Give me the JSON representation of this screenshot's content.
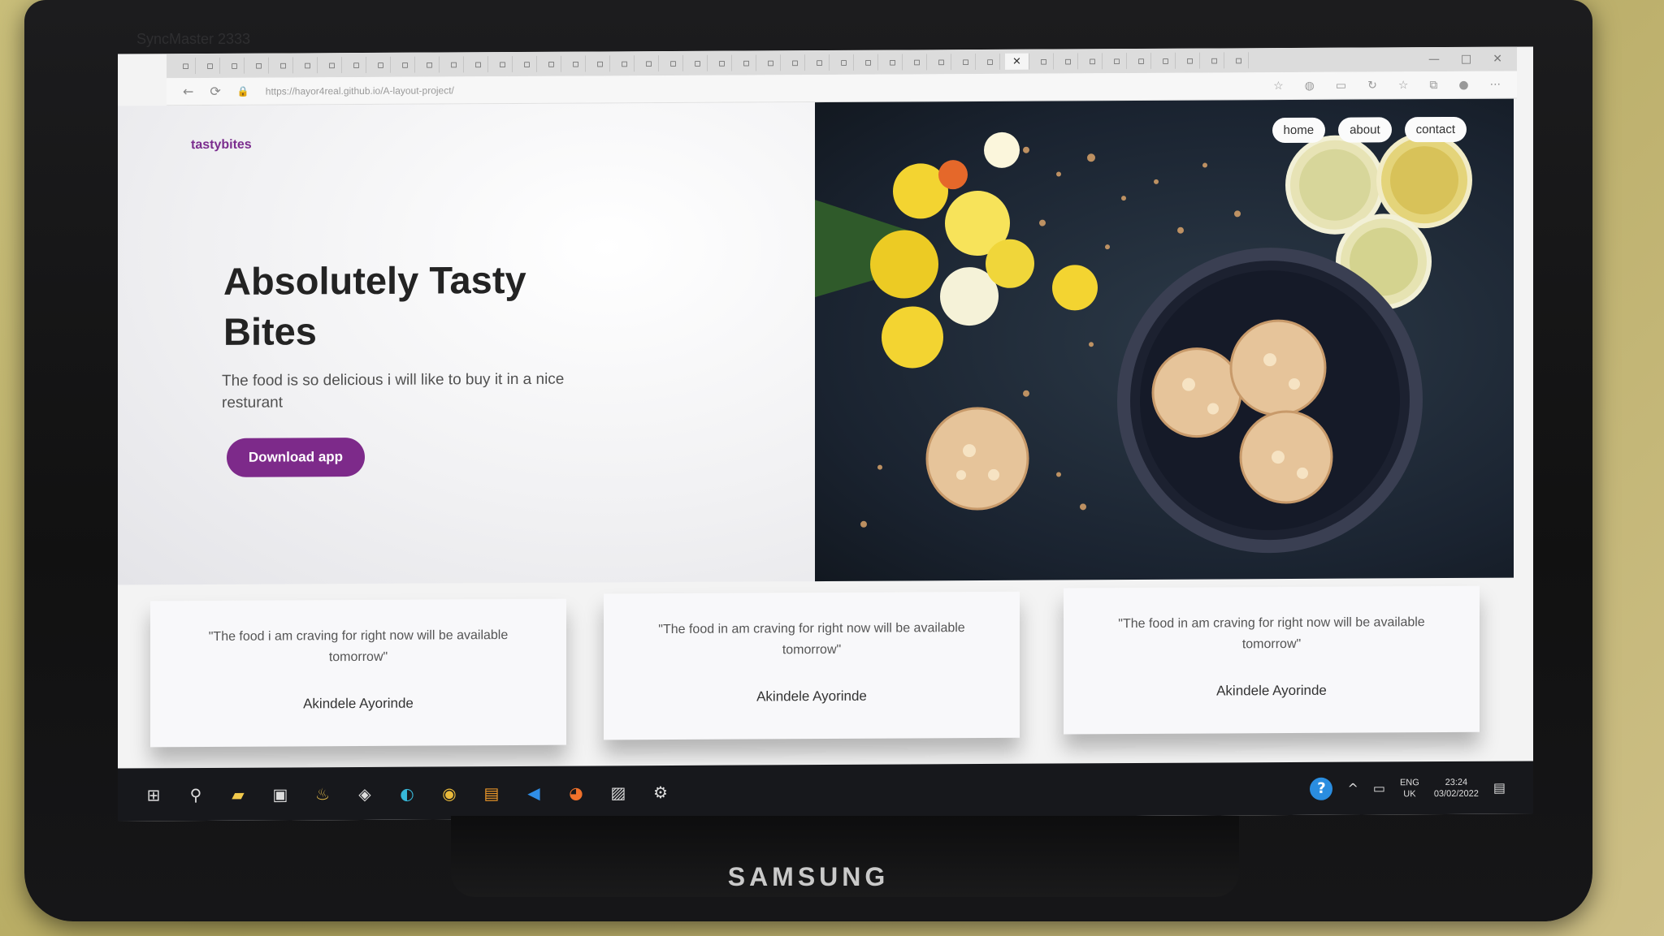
{
  "monitor": {
    "brand": "SAMSUNG",
    "model": "SyncMaster 2333"
  },
  "browser": {
    "url": "https://hayor4real.github.io/A-layout-project/",
    "tab_count": 44
  },
  "site": {
    "logo": "tastybites",
    "nav": [
      "home",
      "about",
      "contact"
    ],
    "hero": {
      "title": "Absolutely Tasty Bites",
      "subtitle": "The food is so delicious i will like to buy it in a nice resturant",
      "cta": "Download app"
    },
    "testimonials": [
      {
        "quote": "\"The food i am craving for right now will be available tomorrow\"",
        "author": "Akindele Ayorinde"
      },
      {
        "quote": "\"The food in am craving for right now will be available tomorrow\"",
        "author": "Akindele Ayorinde"
      },
      {
        "quote": "\"The food in am craving for right now will be available tomorrow\"",
        "author": "Akindele Ayorinde"
      }
    ]
  },
  "taskbar": {
    "lang_line1": "ENG",
    "lang_line2": "UK",
    "time": "23:24",
    "date": "03/02/2022"
  },
  "colors": {
    "accent": "#7d2a8a",
    "logo": "#7b2d8e",
    "taskbar": "#17181c",
    "hero_bg": "#1a2330"
  }
}
